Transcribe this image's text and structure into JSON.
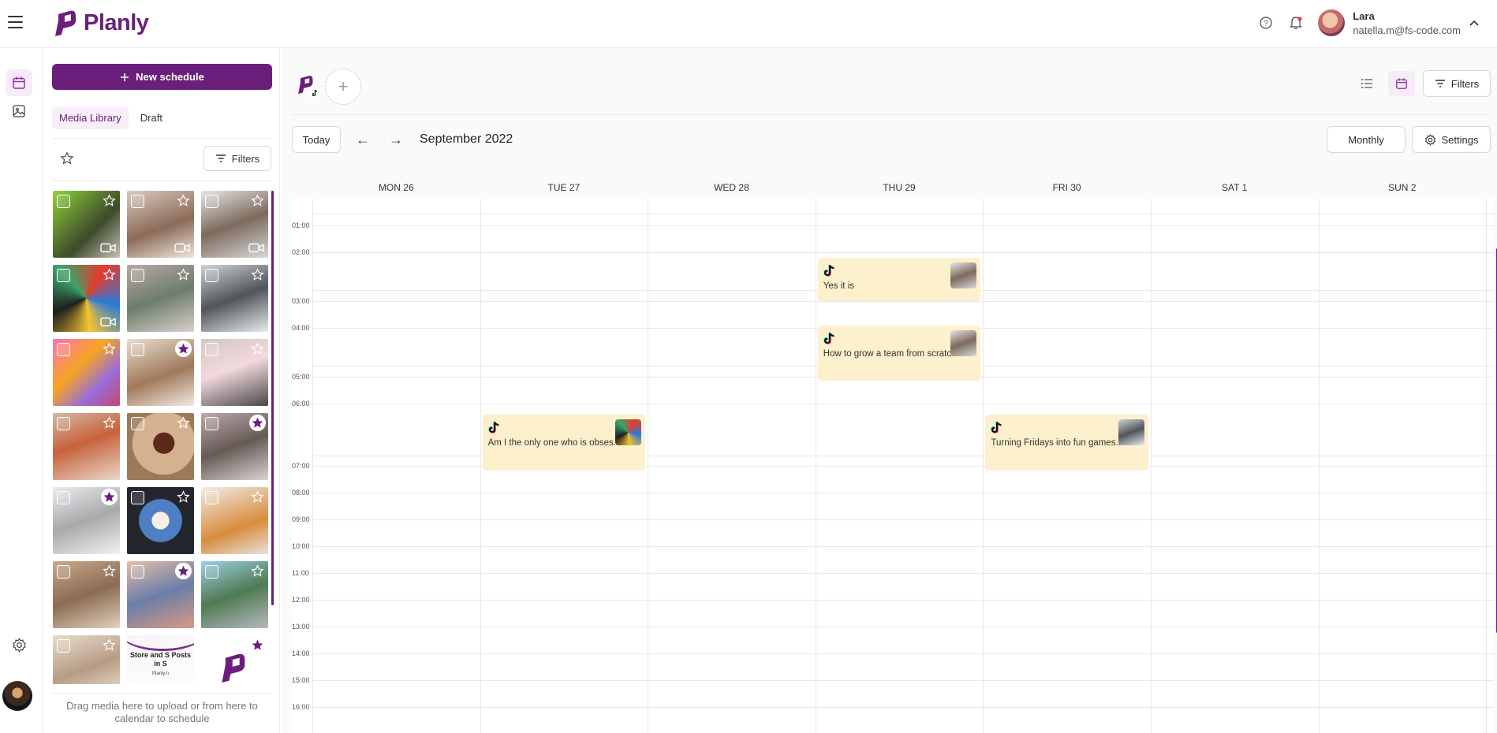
{
  "app": {
    "name": "Planly",
    "brand_color": "#6b1f7c"
  },
  "header": {
    "user_name": "Lara",
    "user_email": "natella.m@fs-code.com"
  },
  "sidebar": {
    "new_schedule_label": "New schedule",
    "tabs": [
      {
        "label": "Media Library",
        "active": true
      },
      {
        "label": "Draft",
        "active": false
      }
    ],
    "filters_label": "Filters",
    "drop_note": "Drag media here to upload or from here to calendar to schedule",
    "media": [
      {
        "starred": false,
        "video": true
      },
      {
        "starred": false,
        "video": true
      },
      {
        "starred": false,
        "video": true
      },
      {
        "starred": false,
        "video": true
      },
      {
        "starred": false,
        "video": false
      },
      {
        "starred": false,
        "video": false
      },
      {
        "starred": false,
        "video": false
      },
      {
        "starred": true,
        "video": false
      },
      {
        "starred": false,
        "video": false
      },
      {
        "starred": false,
        "video": false
      },
      {
        "starred": false,
        "video": false
      },
      {
        "starred": true,
        "video": false
      },
      {
        "starred": true,
        "video": false
      },
      {
        "starred": false,
        "video": false
      },
      {
        "starred": false,
        "video": false
      },
      {
        "starred": false,
        "video": false
      },
      {
        "starred": true,
        "video": false
      },
      {
        "starred": false,
        "video": false
      },
      {
        "starred": false,
        "video": false
      },
      {
        "starred": false,
        "video": false
      },
      {
        "starred": true,
        "video": false
      }
    ],
    "promo_text": "Store and S Posts in S",
    "promo_sub": "Planly.n"
  },
  "main": {
    "filters_label": "Filters",
    "today_label": "Today",
    "month_label": "September 2022",
    "view_label": "Monthly",
    "settings_label": "Settings",
    "days": [
      "MON 26",
      "TUE 27",
      "WED 28",
      "THU 29",
      "FRI 30",
      "SAT 1",
      "SUN 2"
    ],
    "hours": [
      "01:00",
      "02:00",
      "03:00",
      "04:00",
      "05:00",
      "06:00",
      "07:00",
      "08:00",
      "09:00",
      "10:00",
      "11:00",
      "12:00",
      "13:00",
      "14:00",
      "15:00",
      "16:00"
    ],
    "events": [
      {
        "day": "THU 29",
        "text": "Yes it is"
      },
      {
        "day": "THU 29",
        "text": "How to grow a team from scratc..."
      },
      {
        "day": "TUE 27",
        "text": "Am I the only one who is obses..."
      },
      {
        "day": "FRI 30",
        "text": "Turning Fridays into fun games..."
      }
    ]
  },
  "icons": {
    "menu": "hamburger-icon",
    "help": "help-circle-icon",
    "bell": "bell-icon",
    "chevron": "chevron-up-icon",
    "calendar": "calendar-icon",
    "image": "image-icon",
    "gear": "gear-icon",
    "list": "list-icon",
    "filter": "filter-icon",
    "tiktok": "tiktok-icon",
    "star": "star-icon"
  }
}
